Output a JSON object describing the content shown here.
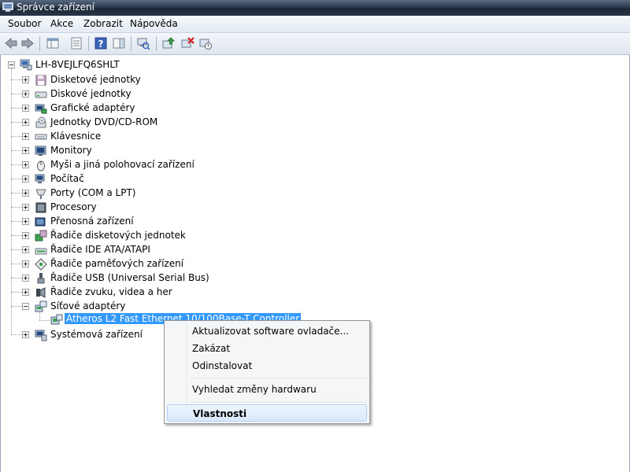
{
  "window": {
    "title": "Správce zařízení"
  },
  "menubar": [
    "Soubor",
    "Akce",
    "Zobrazit",
    "Nápověda"
  ],
  "toolbar": {
    "buttons": [
      "back-icon",
      "forward-icon",
      "show-hide-console-tree-icon",
      "properties-icon",
      "help-icon",
      "action-pane-icon",
      "scan-hardware-icon",
      "update-driver-icon",
      "uninstall-icon",
      "disable-icon"
    ]
  },
  "tree": {
    "root": "LH-8VEJLFQ6SHLT",
    "categories": [
      {
        "label": "Disketové jednotky",
        "icon": "floppy-icon"
      },
      {
        "label": "Diskové jednotky",
        "icon": "disk-drive-icon"
      },
      {
        "label": "Grafické adaptéry",
        "icon": "display-adapter-icon"
      },
      {
        "label": "Jednotky DVD/CD-ROM",
        "icon": "dvd-icon"
      },
      {
        "label": "Klávesnice",
        "icon": "keyboard-icon"
      },
      {
        "label": "Monitory",
        "icon": "monitor-icon"
      },
      {
        "label": "Myši a jiná polohovací zařízení",
        "icon": "mouse-icon"
      },
      {
        "label": "Počítač",
        "icon": "computer-icon"
      },
      {
        "label": "Porty (COM a LPT)",
        "icon": "port-icon"
      },
      {
        "label": "Procesory",
        "icon": "processor-icon"
      },
      {
        "label": "Přenosná zařízení",
        "icon": "portable-device-icon"
      },
      {
        "label": "Řadiče disketových jednotek",
        "icon": "floppy-controller-icon"
      },
      {
        "label": "Řadiče IDE ATA/ATAPI",
        "icon": "ide-controller-icon"
      },
      {
        "label": "Řadiče paměťových zařízení",
        "icon": "storage-controller-icon"
      },
      {
        "label": "Řadiče USB (Universal Serial Bus)",
        "icon": "usb-icon"
      },
      {
        "label": "Řadiče zvuku, videa a her",
        "icon": "sound-icon"
      },
      {
        "label": "Síťové adaptéry",
        "icon": "network-adapter-icon",
        "expanded": true
      },
      {
        "label": "Systémová zařízení",
        "icon": "system-device-icon"
      }
    ],
    "selected_child": "Atheros L2 Fast Ethernet 10/100Base-T Controller"
  },
  "context_menu": {
    "items": [
      "Aktualizovat software ovladače...",
      "Zakázat",
      "Odinstalovat",
      "Vyhledat změny hardwaru",
      "Vlastnosti"
    ]
  }
}
